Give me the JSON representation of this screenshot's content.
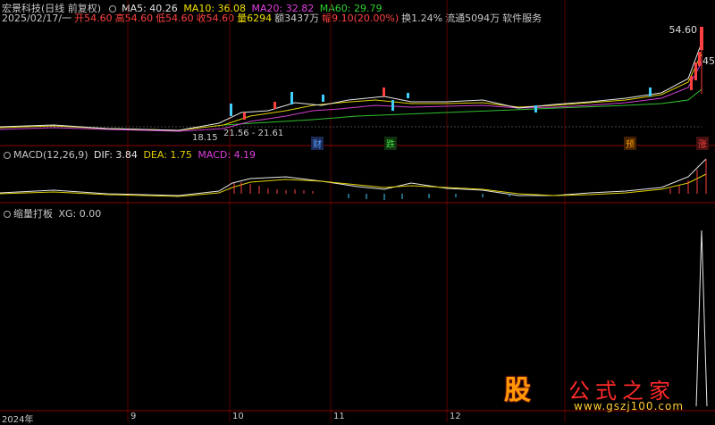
{
  "header": {
    "stock_name": "宏景科技(日线 前复权)",
    "ma": [
      {
        "label": "MA5: 40.26",
        "color": "#e0e0e0"
      },
      {
        "label": "MA10: 36.08",
        "color": "#f0e000"
      },
      {
        "label": "MA20: 32.82",
        "color": "#e040e0"
      },
      {
        "label": "MA60: 29.79",
        "color": "#30d030"
      }
    ]
  },
  "quote": {
    "date": "2025/02/17/一",
    "open": "开54.60",
    "high": "高54.60",
    "low": "低54.60",
    "close": "收54.60",
    "volume": "量6294",
    "amount": "额3437万",
    "change": "幅9.10(20.00%)",
    "turnover": "换1.24%",
    "float": "流通5094万",
    "service": "软件服务"
  },
  "price_labels": {
    "top": "54.60",
    "side": "45",
    "low": "18.15",
    "range": "21.56 - 21.61"
  },
  "events": [
    {
      "text": "财",
      "color": "#5aa0ff",
      "bg": "#1a2a55"
    },
    {
      "text": "跌",
      "color": "#40e040",
      "bg": "#103010"
    },
    {
      "text": "预",
      "color": "#ff9900",
      "bg": "#442200"
    },
    {
      "text": "涨",
      "color": "#ff4040",
      "bg": "#441010"
    }
  ],
  "macd": {
    "label": "MACD(12,26,9)",
    "dif": "DIF: 3.84",
    "dea": "DEA: 1.75",
    "macd": "MACD: 4.19",
    "macd_color": "#e040e0"
  },
  "xg": {
    "label": "缩量打板",
    "value": "XG: 0.00"
  },
  "x_axis": [
    "2024年",
    "9",
    "10",
    "11",
    "12"
  ],
  "watermark": {
    "logo": "股",
    "name": "公式之家",
    "url": "www.gszj100.com"
  }
}
